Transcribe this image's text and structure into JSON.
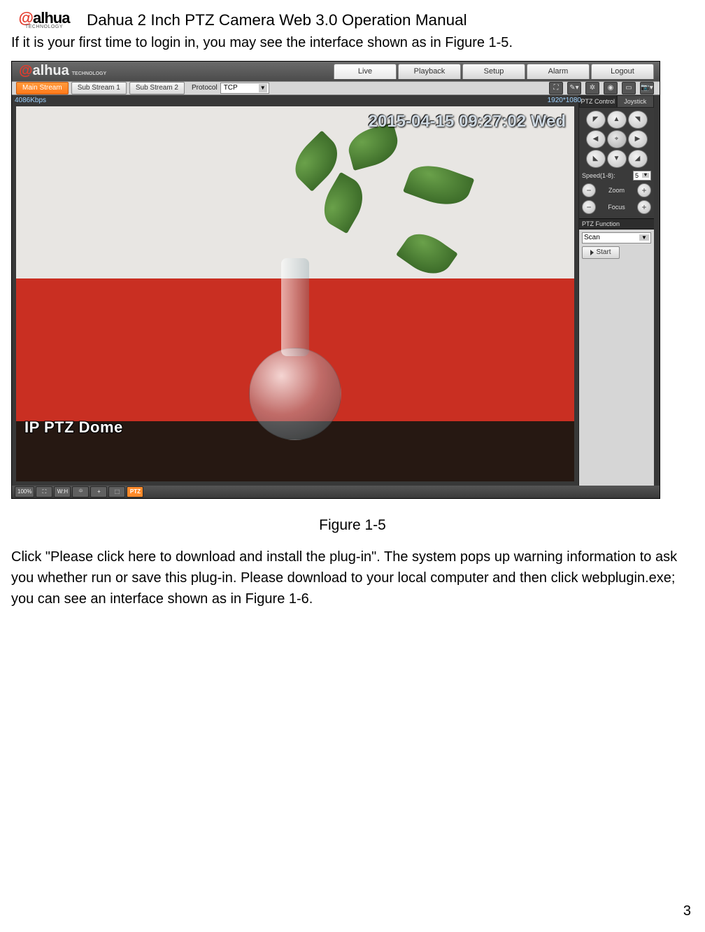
{
  "doc": {
    "logo_main": "alhua",
    "logo_sub": "TECHNOLOGY",
    "title": "Dahua 2 Inch PTZ Camera Web 3.0 Operation Manual",
    "intro_a": "If it is your first time to login in, you may see the interface shown as in ",
    "intro_fig": "Figure 1-5",
    "intro_b": "."
  },
  "shot": {
    "header": {
      "logo": "alhua",
      "logo_sub": "TECHNOLOGY",
      "tabs": [
        "Live",
        "Playback",
        "Setup",
        "Alarm",
        "Logout"
      ],
      "active_tab": 0
    },
    "toolbar": {
      "streams": [
        "Main Stream",
        "Sub Stream 1",
        "Sub Stream 2"
      ],
      "active_stream": 0,
      "protocol_label": "Protocol",
      "protocol_value": "TCP",
      "right_icons": [
        "fit-icon",
        "brush-icon",
        "settings-icon",
        "record-icon",
        "snapshot-icon",
        "camera-icon"
      ]
    },
    "video": {
      "rate": "4086Kbps",
      "resolution": "1920*1080",
      "osd_timestamp": "2015-04-15 09:27:02 Wed",
      "watermark": "IP PTZ Dome"
    },
    "sidebar": {
      "tabs": [
        "PTZ Control",
        "Joystick"
      ],
      "active_tab": 0,
      "dpad_glyphs": [
        "◤",
        "▲",
        "◥",
        "◀",
        "⌖",
        "▶",
        "◣",
        "▼",
        "◢"
      ],
      "speed_label": "Speed(1-8):",
      "speed_value": "5",
      "zoom_label": "Zoom",
      "focus_label": "Focus",
      "section_label": "PTZ Function",
      "func_value": "Scan",
      "start_label": "Start"
    },
    "footer": {
      "buttons": [
        "100%",
        "⛶",
        "W:H",
        "⯐",
        "+",
        "⬚",
        "PTZ"
      ]
    }
  },
  "caption": "Figure 1-5",
  "para": "Click \"Please click here to download and install the plug-in\". The system pops up warning information to ask you whether run or save this plug-in.  Please download to your local computer and then click webplugin.exe; you can see an interface shown as in Figure 1-6.",
  "pagenum": "3"
}
